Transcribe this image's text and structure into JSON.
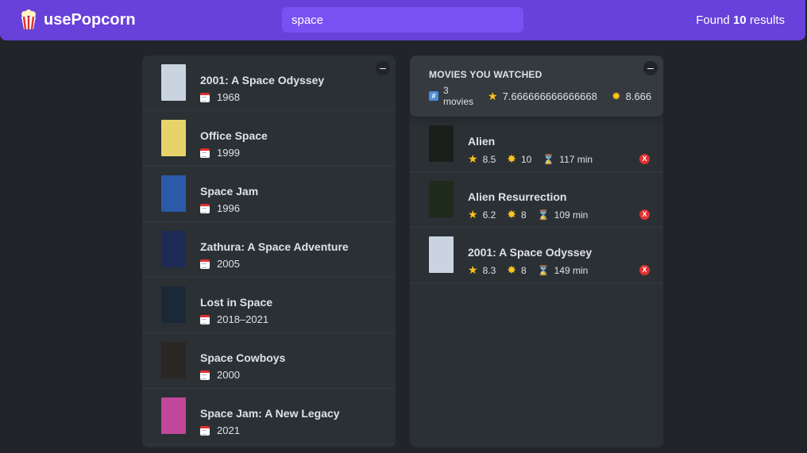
{
  "nav": {
    "logo_text": "usePopcorn",
    "search_value": "space",
    "found_prefix": "Found",
    "found_count": "10",
    "found_suffix": "results"
  },
  "list": {
    "toggle": "–",
    "movies": [
      {
        "title": "2001: A Space Odyssey",
        "year": "1968",
        "poster_color": "#c9d4e0"
      },
      {
        "title": "Office Space",
        "year": "1999",
        "poster_color": "#e8d36a"
      },
      {
        "title": "Space Jam",
        "year": "1996",
        "poster_color": "#2a5aa8"
      },
      {
        "title": "Zathura: A Space Adventure",
        "year": "2005",
        "poster_color": "#1c2a55"
      },
      {
        "title": "Lost in Space",
        "year": "2018–2021",
        "poster_color": "#1b2838"
      },
      {
        "title": "Space Cowboys",
        "year": "2000",
        "poster_color": "#2a2622"
      },
      {
        "title": "Space Jam: A New Legacy",
        "year": "2021",
        "poster_color": "#c0479a"
      }
    ]
  },
  "watched": {
    "toggle": "–",
    "heading": "MOVIES YOU WATCHED",
    "count_num": "3",
    "count_label": "movies",
    "avg_imdb": "7.666666666666668",
    "avg_user": "8.666",
    "movies": [
      {
        "title": "Alien",
        "imdb": "8.5",
        "user": "10",
        "runtime": "117 min",
        "poster_color": "#1a1f1a"
      },
      {
        "title": "Alien Resurrection",
        "imdb": "6.2",
        "user": "8",
        "runtime": "109 min",
        "poster_color": "#1e2a1c"
      },
      {
        "title": "2001: A Space Odyssey",
        "imdb": "8.3",
        "user": "8",
        "runtime": "149 min",
        "poster_color": "#c9d4e0"
      }
    ],
    "delete_label": "X"
  },
  "colors": {
    "nav_bg": "#6741d9",
    "search_bg": "#7950f2",
    "page_bg": "#212529",
    "box_bg": "#2b3035",
    "delete_red": "#e03131",
    "star_yellow": "#fcc419"
  }
}
